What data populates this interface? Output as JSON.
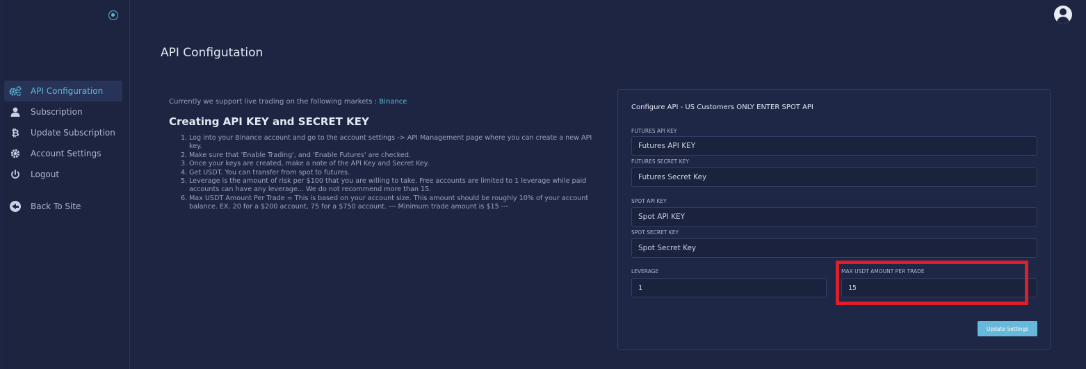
{
  "page": {
    "title": "API Configutation"
  },
  "sidebar": {
    "items": [
      {
        "label": "API Configuration",
        "icon": "gears-icon",
        "active": true
      },
      {
        "label": "Subscription",
        "icon": "user-icon",
        "active": false
      },
      {
        "label": "Update Subscription",
        "icon": "bitcoin-icon",
        "active": false
      },
      {
        "label": "Account Settings",
        "icon": "gear-icon",
        "active": false
      },
      {
        "label": "Logout",
        "icon": "power-icon",
        "active": false
      }
    ],
    "back_label": "Back To Site"
  },
  "intro": {
    "text": "Currently we support live trading on the following markets : ",
    "market": "Binance"
  },
  "instructions": {
    "title": "Creating API KEY and SECRET KEY",
    "steps": [
      {
        "num": "1.",
        "text": "Log into your Binance account and go to the account settings -> API Management page where you can create a new API key."
      },
      {
        "num": "2.",
        "text": "Make sure that 'Enable Trading', and 'Enable Futures' are checked."
      },
      {
        "num": "3.",
        "text": "Once your keys are created, make a note of the API Key and Secret Key."
      },
      {
        "num": "4.",
        "text": "Get USDT. You can transfer from spot to futures."
      },
      {
        "num": "5.",
        "text": "Leverage is the amount of risk per $100 that you are willing to take. Free accounts are limited to 1 leverage while paid accounts can have any leverage... We do not recommend more than 15."
      },
      {
        "num": "6.",
        "text": "Max USDT Amount Per Trade = This is based on your account size. This amount should be roughly 10% of your account balance. EX. 20 for a $200 account, 75 for a $750 account. --- Minimum trade amount is $15 ---"
      }
    ]
  },
  "form": {
    "title": "Configure API - US Customers ONLY ENTER SPOT API",
    "futures_api_key": {
      "label": "FUTURES API KEY",
      "placeholder": "Futures API KEY"
    },
    "futures_secret_key": {
      "label": "FUTURES SECRET KEY",
      "placeholder": "Futures Secret Key"
    },
    "spot_api_key": {
      "label": "SPOT API KEY",
      "placeholder": "Spot API KEY"
    },
    "spot_secret_key": {
      "label": "SPOT SECRET KEY",
      "placeholder": "Spot Secret Key"
    },
    "leverage": {
      "label": "LEVERAGE",
      "value": "1"
    },
    "max_usdt": {
      "label": "MAX USDT AMOUNT PER TRADE",
      "value": "15"
    },
    "submit_label": "Update Settings"
  },
  "colors": {
    "background": "#1e2543",
    "accent": "#5fb6d8",
    "button": "#66b9da",
    "highlight": "#e01e2a"
  }
}
